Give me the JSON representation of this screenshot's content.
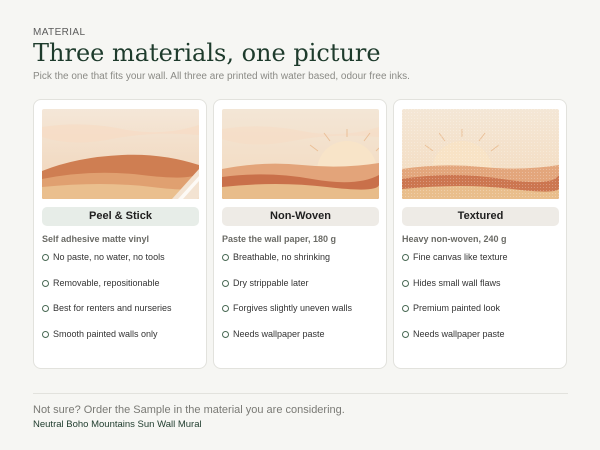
{
  "header": {
    "eyebrow": "MATERIAL",
    "title": "Three materials, one picture",
    "subtitle": "Pick the one that fits your wall. All three are printed with water based, odour free inks."
  },
  "cards": [
    {
      "label": "Peel & Stick",
      "spec": "Self adhesive matte vinyl",
      "features": [
        "No paste, no water, no tools",
        "Removable, repositionable",
        "Best for renters and nurseries",
        "Smooth painted walls only"
      ]
    },
    {
      "label": "Non-Woven",
      "spec": "Paste the wall paper, 180 g",
      "features": [
        "Breathable, no shrinking",
        "Dry strippable later",
        "Forgives slightly uneven walls",
        "Needs wallpaper paste"
      ]
    },
    {
      "label": "Textured",
      "spec": "Heavy non-woven, 240 g",
      "features": [
        "Fine canvas like texture",
        "Hides small wall flaws",
        "Premium painted look",
        "Needs wallpaper paste"
      ]
    }
  ],
  "footer": {
    "note": "Not sure? Order the Sample in the material you are considering.",
    "product": "Neutral Boho Mountains Sun Wall Mural"
  },
  "colors": {
    "accent": "#1e3b2c",
    "selected_pill": "#e7ede8",
    "pill": "#eeebe6"
  }
}
